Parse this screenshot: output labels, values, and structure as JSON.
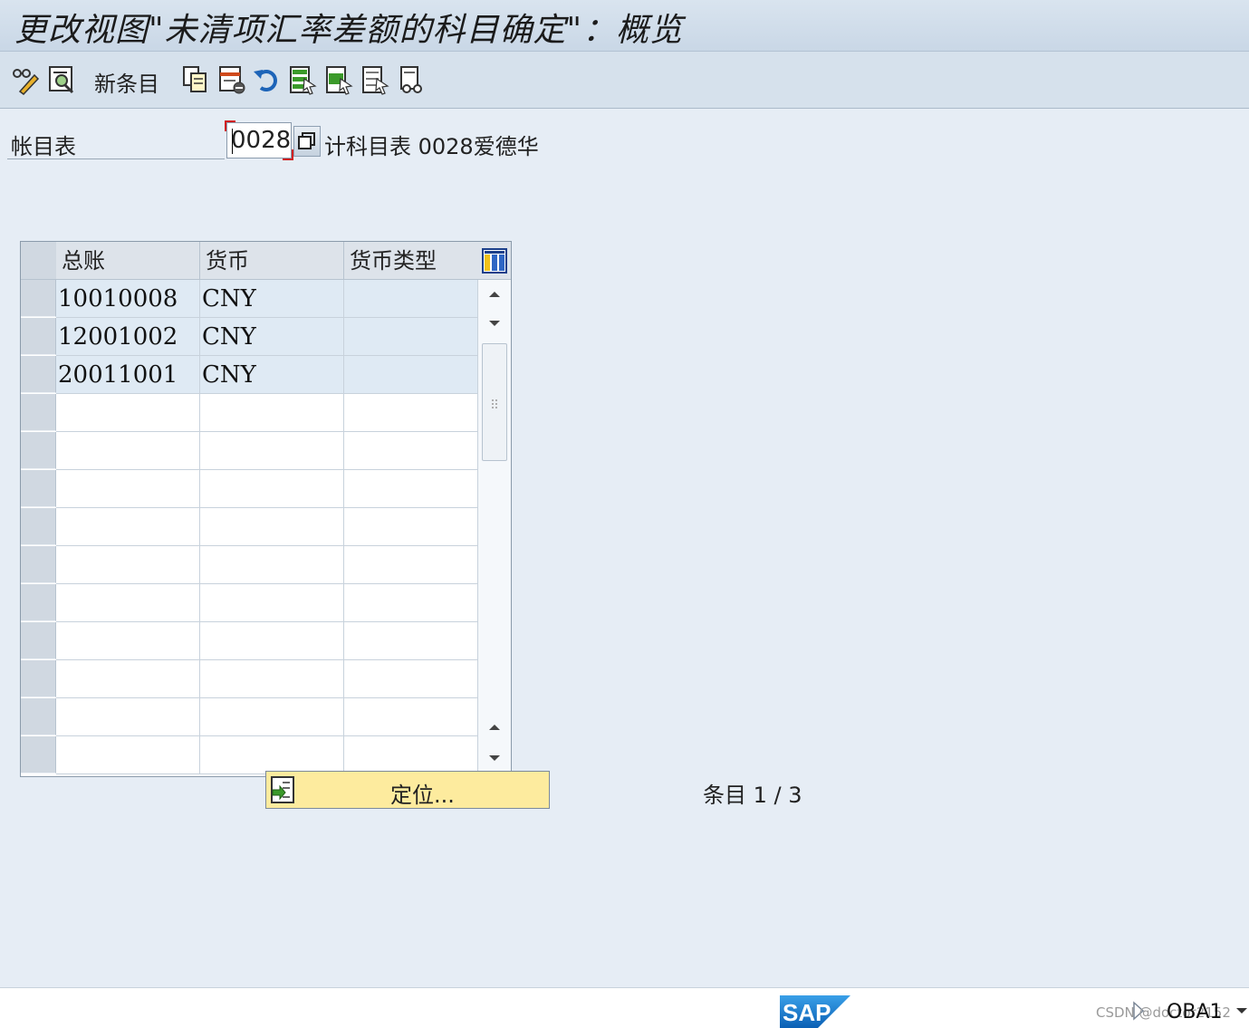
{
  "window": {
    "title": "更改视图\"未清项汇率差额的科目确定\"：概览"
  },
  "toolbar": {
    "new_entries_label": "新条目",
    "icons": [
      "edit-toggle-icon",
      "details-icon",
      "copy-icon",
      "delete-icon",
      "undo-icon",
      "select-all-icon",
      "select-block-icon",
      "deselect-all-icon",
      "print-icon"
    ]
  },
  "header": {
    "chart_of_accounts_label": "帐目表",
    "chart_of_accounts_value": "0028",
    "chart_of_accounts_desc": "计科目表 0028爱德华"
  },
  "table": {
    "columns": [
      "总账",
      "货币",
      "货币类型"
    ],
    "rows": [
      [
        "10010008",
        "CNY",
        ""
      ],
      [
        "12001002",
        "CNY",
        ""
      ],
      [
        "20011001",
        "CNY",
        ""
      ]
    ],
    "empty_rows": 10
  },
  "footer": {
    "position_button_label": "定位...",
    "entries_label": "条目 1 / 3"
  },
  "statusbar": {
    "logo": "SAP",
    "watermark": "CSDN @doctor2152",
    "transaction": "OBA1"
  },
  "colors": {
    "background": "#e6edf5",
    "table_filled_row": "#dfeaf4",
    "position_button": "#fdeb9e",
    "required_marker": "#d02020",
    "sap_blue": "#1a73c5"
  }
}
